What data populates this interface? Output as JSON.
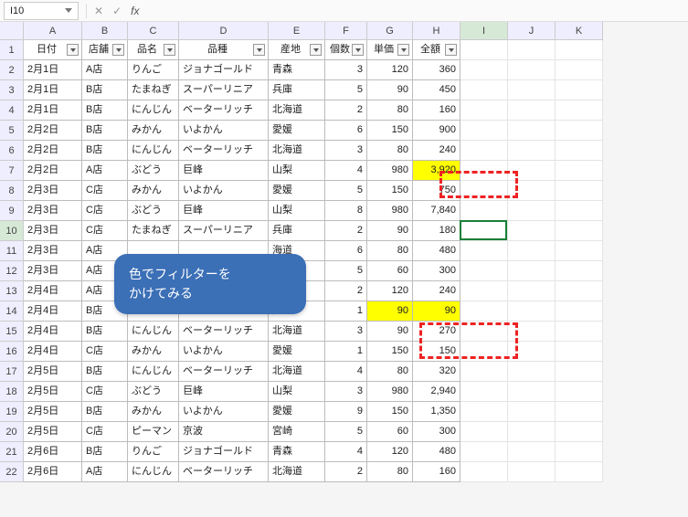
{
  "namebox": "I10",
  "fx": "fx",
  "col_letters": [
    "A",
    "B",
    "C",
    "D",
    "E",
    "F",
    "G",
    "H",
    "I",
    "J",
    "K"
  ],
  "col_widths": [
    "wA",
    "wB",
    "wC",
    "wD",
    "wE",
    "wF",
    "wG",
    "wH",
    "wI",
    "wJ",
    "wK"
  ],
  "headers": [
    "日付",
    "店舗",
    "品名",
    "品種",
    "産地",
    "個数",
    "単価",
    "全額"
  ],
  "rows": [
    {
      "n": 2,
      "c": [
        "2月1日",
        "A店",
        "りんご",
        "ジョナゴールド",
        "青森",
        "3",
        "120",
        "360"
      ]
    },
    {
      "n": 3,
      "c": [
        "2月1日",
        "B店",
        "たまねぎ",
        "スーパーリニア",
        "兵庫",
        "5",
        "90",
        "450"
      ]
    },
    {
      "n": 4,
      "c": [
        "2月1日",
        "B店",
        "にんじん",
        "ベーターリッチ",
        "北海道",
        "2",
        "80",
        "160"
      ]
    },
    {
      "n": 5,
      "c": [
        "2月2日",
        "B店",
        "みかん",
        "いよかん",
        "愛媛",
        "6",
        "150",
        "900"
      ]
    },
    {
      "n": 6,
      "c": [
        "2月2日",
        "B店",
        "にんじん",
        "ベーターリッチ",
        "北海道",
        "3",
        "80",
        "240"
      ]
    },
    {
      "n": 7,
      "c": [
        "2月2日",
        "A店",
        "ぶどう",
        "巨峰",
        "山梨",
        "4",
        "980",
        "3,920"
      ],
      "hl": [
        7
      ]
    },
    {
      "n": 8,
      "c": [
        "2月3日",
        "C店",
        "みかん",
        "いよかん",
        "愛媛",
        "5",
        "150",
        "750"
      ]
    },
    {
      "n": 9,
      "c": [
        "2月3日",
        "C店",
        "ぶどう",
        "巨峰",
        "山梨",
        "8",
        "980",
        "7,840"
      ]
    },
    {
      "n": 10,
      "c": [
        "2月3日",
        "C店",
        "たまねぎ",
        "スーパーリニア",
        "兵庫",
        "2",
        "90",
        "180"
      ]
    },
    {
      "n": 11,
      "c": [
        "2月3日",
        "A店",
        "",
        "",
        "海道",
        "6",
        "80",
        "480"
      ]
    },
    {
      "n": 12,
      "c": [
        "2月3日",
        "A店",
        "",
        "",
        "崎",
        "5",
        "60",
        "300"
      ]
    },
    {
      "n": 13,
      "c": [
        "2月4日",
        "A店",
        "",
        "",
        "森",
        "2",
        "120",
        "240"
      ]
    },
    {
      "n": 14,
      "c": [
        "2月4日",
        "B店",
        "",
        "",
        "庫",
        "1",
        "90",
        "90"
      ],
      "hl": [
        6,
        7
      ]
    },
    {
      "n": 15,
      "c": [
        "2月4日",
        "B店",
        "にんじん",
        "ベーターリッチ",
        "北海道",
        "3",
        "90",
        "270"
      ]
    },
    {
      "n": 16,
      "c": [
        "2月4日",
        "C店",
        "みかん",
        "いよかん",
        "愛媛",
        "1",
        "150",
        "150"
      ]
    },
    {
      "n": 17,
      "c": [
        "2月5日",
        "B店",
        "にんじん",
        "ベーターリッチ",
        "北海道",
        "4",
        "80",
        "320"
      ]
    },
    {
      "n": 18,
      "c": [
        "2月5日",
        "C店",
        "ぶどう",
        "巨峰",
        "山梨",
        "3",
        "980",
        "2,940"
      ]
    },
    {
      "n": 19,
      "c": [
        "2月5日",
        "B店",
        "みかん",
        "いよかん",
        "愛媛",
        "9",
        "150",
        "1,350"
      ]
    },
    {
      "n": 20,
      "c": [
        "2月5日",
        "C店",
        "ピーマン",
        "京波",
        "宮崎",
        "5",
        "60",
        "300"
      ]
    },
    {
      "n": 21,
      "c": [
        "2月6日",
        "B店",
        "りんご",
        "ジョナゴールド",
        "青森",
        "4",
        "120",
        "480"
      ]
    },
    {
      "n": 22,
      "c": [
        "2月6日",
        "A店",
        "にんじん",
        "ベーターリッチ",
        "北海道",
        "2",
        "80",
        "160"
      ]
    }
  ],
  "callout_l1": "色でフィルターを",
  "callout_l2": "かけてみる",
  "selected_col_idx": 8,
  "selected_row_n": 10
}
